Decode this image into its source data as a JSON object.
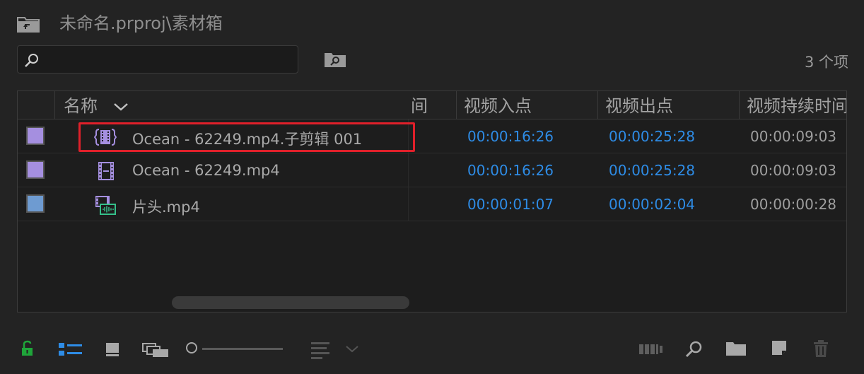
{
  "header": {
    "breadcrumb": "未命名.prproj\\素材箱",
    "item_count": "3 个项"
  },
  "search": {
    "value": "",
    "placeholder": ""
  },
  "table": {
    "columns": {
      "name": "名称",
      "truncated": "间",
      "video_in": "视频入点",
      "video_out": "视频出点",
      "video_duration": "视频持续时间"
    },
    "rows": [
      {
        "label_color": "#a58fe0",
        "icon": "subclip-icon",
        "name": "Ocean - 62249.mp4.子剪辑 001",
        "video_in": "00:00:16:26",
        "video_out": "00:00:25:28",
        "video_duration": "00:00:09:03",
        "highlighted": true
      },
      {
        "label_color": "#a58fe0",
        "icon": "video-clip-icon",
        "name": "Ocean - 62249.mp4",
        "video_in": "00:00:16:26",
        "video_out": "00:00:25:28",
        "video_duration": "00:00:09:03",
        "highlighted": false
      },
      {
        "label_color": "#6e9bd1",
        "icon": "av-clip-icon",
        "name": "片头.mp4",
        "video_in": "00:00:01:07",
        "video_out": "00:00:02:04",
        "video_duration": "00:00:00:28",
        "highlighted": false
      }
    ]
  },
  "colors": {
    "timecode": "#2e8ce6",
    "highlight": "#e0202a",
    "lock_active": "#1fa53a",
    "list_view_active": "#2e8ce6"
  },
  "toolbar": {
    "left_icons": [
      "lock-open-icon",
      "list-view-icon",
      "icon-view-icon",
      "freeform-view-icon",
      "zoom-slider",
      "sort-icon",
      "chevron-down-icon"
    ],
    "right_icons": [
      "automate-to-sequence-icon",
      "find-icon",
      "new-bin-icon",
      "new-item-icon",
      "trash-icon"
    ]
  }
}
